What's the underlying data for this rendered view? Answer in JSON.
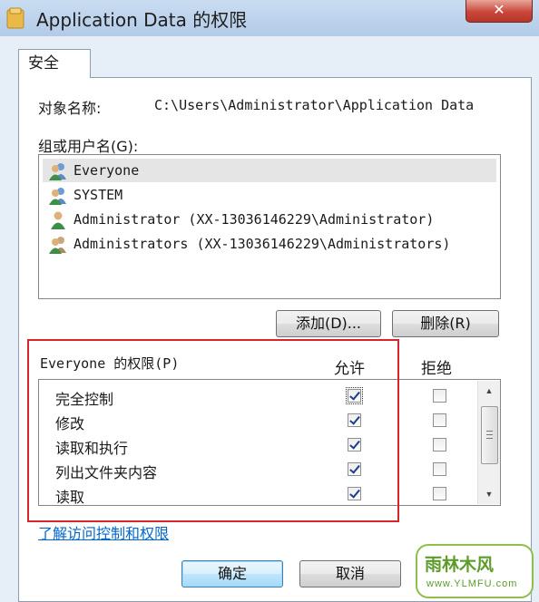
{
  "window": {
    "title": "Application Data 的权限",
    "close_label": "✕"
  },
  "tab": {
    "label": "安全"
  },
  "object": {
    "label": "对象名称:",
    "value": "C:\\Users\\Administrator\\Application Data"
  },
  "groups": {
    "label": "组或用户名(G):",
    "items": [
      {
        "name": "Everyone",
        "selected": true
      },
      {
        "name": "SYSTEM",
        "selected": false
      },
      {
        "name": "Administrator (XX-13036146229\\Administrator)",
        "selected": false
      },
      {
        "name": "Administrators (XX-13036146229\\Administrators)",
        "selected": false
      }
    ]
  },
  "buttons": {
    "add": "添加(D)...",
    "remove": "删除(R)",
    "ok": "确定",
    "cancel": "取消"
  },
  "permissions": {
    "header": "Everyone 的权限(P)",
    "allow_header": "允许",
    "deny_header": "拒绝",
    "rows": [
      {
        "name": "完全控制",
        "allow": true,
        "deny": false
      },
      {
        "name": "修改",
        "allow": true,
        "deny": false
      },
      {
        "name": "读取和执行",
        "allow": true,
        "deny": false
      },
      {
        "name": "列出文件夹内容",
        "allow": true,
        "deny": false
      },
      {
        "name": "读取",
        "allow": true,
        "deny": false
      }
    ]
  },
  "link": {
    "text": "了解访问控制和权限"
  },
  "watermark": {
    "title": "雨林木风",
    "sub": "www.YLMFU.com"
  },
  "colors": {
    "highlight_box": "#d7262b",
    "link": "#0066cc"
  }
}
